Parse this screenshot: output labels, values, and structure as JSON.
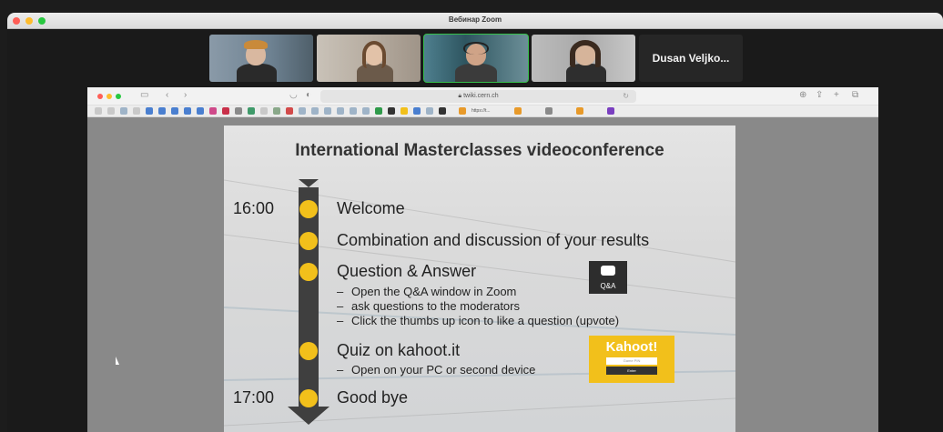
{
  "zoom": {
    "title": "Вебинар Zoom",
    "participant_name": "Dusan Veljko..."
  },
  "browser": {
    "url": "twiki.cern.ch",
    "bookmark_text": "https://t..."
  },
  "slide": {
    "title": "International Masterclasses videoconference",
    "times": {
      "start": "16:00",
      "end": "17:00"
    },
    "items": {
      "welcome": "Welcome",
      "combination": "Combination and discussion of your results",
      "qa": "Question & Answer",
      "quiz": "Quiz on kahoot.it",
      "goodbye": "Good bye"
    },
    "qa_subitems": [
      "Open the Q&A window in Zoom",
      "ask questions to the moderators",
      "Click the thumbs up icon to like a question (upvote)"
    ],
    "quiz_subitems": [
      "Open on your PC or second device"
    ],
    "qa_icon_label": "Q&A",
    "kahoot": {
      "logo": "Kahoot!",
      "input_placeholder": "Game PIN",
      "button": "Enter"
    }
  },
  "colors": {
    "timeline": "#3f3f3f",
    "timeline_dot": "#f2c01b",
    "active_speaker": "#35c04a",
    "kahoot": "#f2c01b"
  }
}
